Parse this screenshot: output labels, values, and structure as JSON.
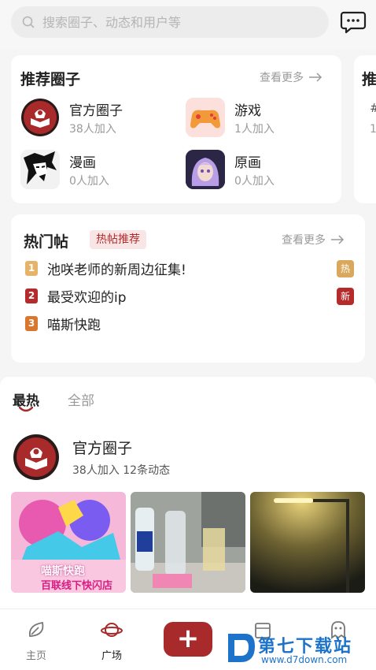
{
  "search": {
    "placeholder": "搜索圈子、动态和用户等"
  },
  "recommended": {
    "title": "推荐圈子",
    "more": "查看更多",
    "side_title": "推",
    "side_sub": "#",
    "side_count": "1",
    "circles": [
      {
        "name": "官方圈子",
        "members": "38人加入"
      },
      {
        "name": "游戏",
        "members": "1人加入"
      },
      {
        "name": "漫画",
        "members": "0人加入"
      },
      {
        "name": "原画",
        "members": "0人加入"
      }
    ]
  },
  "hot": {
    "title": "热门帖",
    "tag": "热帖推荐",
    "more": "查看更多",
    "items": [
      {
        "rank": "1",
        "text": "池咲老师的新周边征集!",
        "badge": "热",
        "rank_color": "#e6b36a",
        "badge_color": "#d9a85d"
      },
      {
        "rank": "2",
        "text": "最受欢迎的ip",
        "badge": "新",
        "rank_color": "#b52b2b",
        "badge_color": "#b52b2b"
      },
      {
        "rank": "3",
        "text": "喵斯快跑",
        "badge": "",
        "rank_color": "#d9772f",
        "badge_color": ""
      }
    ]
  },
  "feed": {
    "tabs": [
      {
        "label": "最热"
      },
      {
        "label": "全部"
      }
    ],
    "circle_name": "官方圈子",
    "circle_stats": "38人加入  12条动态",
    "poster_text_1": "喵斯快跑",
    "poster_text_2": "百联线下快闪店"
  },
  "nav": {
    "items": [
      {
        "label": "主页"
      },
      {
        "label": "广场"
      },
      {
        "label": ""
      },
      {
        "label": ""
      }
    ],
    "post_label": "+"
  },
  "watermark": {
    "title": "第七下载站",
    "url": "www.d7down.com"
  },
  "colors": {
    "accent": "#a82a2a",
    "watermark": "#1c73c9"
  }
}
